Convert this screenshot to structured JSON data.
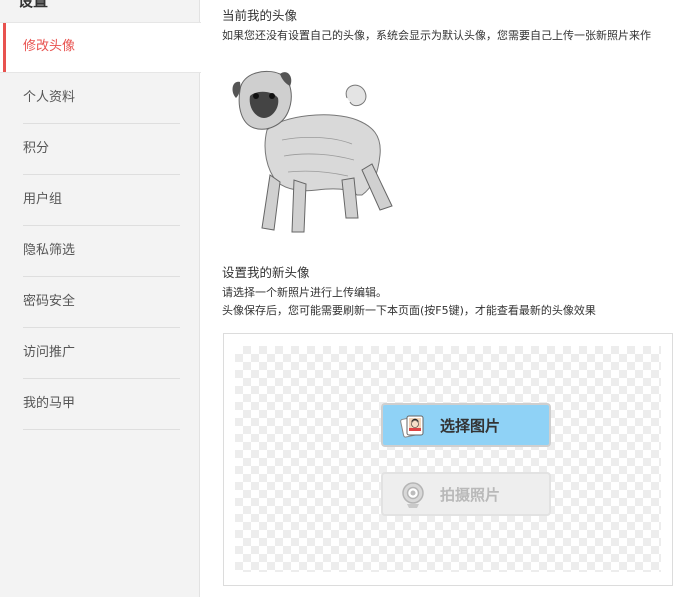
{
  "sidebar": {
    "title": "设置",
    "items": [
      {
        "label": "修改头像",
        "active": true
      },
      {
        "label": "个人资料"
      },
      {
        "label": "积分"
      },
      {
        "label": "用户组"
      },
      {
        "label": "隐私筛选"
      },
      {
        "label": "密码安全"
      },
      {
        "label": "访问推广"
      },
      {
        "label": "我的马甲"
      }
    ]
  },
  "current_avatar": {
    "heading": "当前我的头像",
    "note": "如果您还没有设置自己的头像，系统会显示为默认头像，您需要自己上传一张新照片来作"
  },
  "new_avatar": {
    "heading": "设置我的新头像",
    "line1": "请选择一个新照片进行上传编辑。",
    "line2": "头像保存后，您可能需要刷新一下本页面(按F5键)，才能查看最新的头像效果"
  },
  "upload": {
    "select_label": "选择图片",
    "camera_label": "拍摄照片"
  },
  "colors": {
    "accent": "#e8524f",
    "select_button": "#8fd2f6",
    "sidebar_bg": "#f3f3f3"
  }
}
